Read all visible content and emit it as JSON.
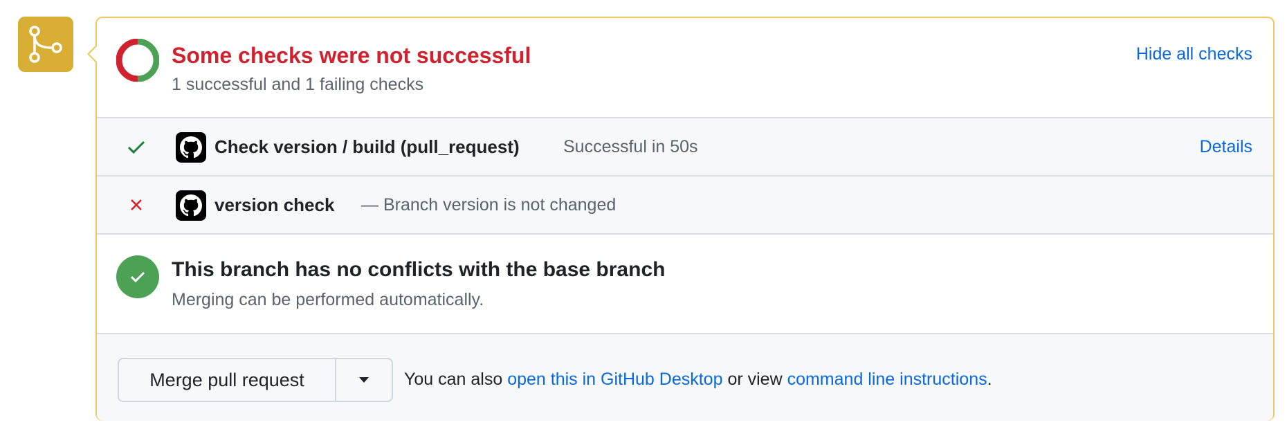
{
  "colors": {
    "accent_link": "#0969da",
    "fail_red": "#cf222e",
    "success_green": "#4ca155",
    "merge_badge_gold": "#d8ae34",
    "panel_border": "#eec961"
  },
  "status": {
    "title": "Some checks were not successful",
    "subtitle": "1 successful and 1 failing checks",
    "hide_link": "Hide all checks",
    "ring_progress": {
      "success": 1,
      "failing": 1
    }
  },
  "checks": [
    {
      "state": "success",
      "state_icon": "check-icon",
      "avatar_icon": "github-icon",
      "name": "Check version / build (pull_request)",
      "status_text": "Successful in 50s",
      "details_label": "Details"
    },
    {
      "state": "failure",
      "state_icon": "x-icon",
      "avatar_icon": "github-icon",
      "name": "version check",
      "description": "— Branch version is not changed"
    }
  ],
  "conflicts": {
    "icon": "check-circle-icon",
    "title": "This branch has no conflicts with the base branch",
    "subtitle": "Merging can be performed automatically."
  },
  "merge": {
    "button_label": "Merge pull request",
    "dropdown_icon": "caret-down-icon",
    "text_prefix": "You can also",
    "desktop_link": "open this in GitHub Desktop",
    "text_middle": "or view",
    "cli_link": "command line instructions",
    "text_suffix": "."
  },
  "badge_icon": "git-merge-icon"
}
